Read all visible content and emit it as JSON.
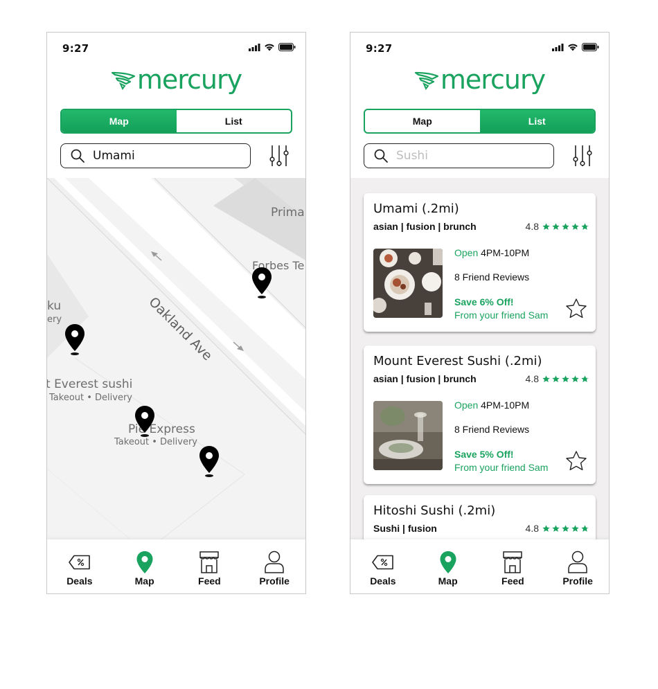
{
  "left_screen": {
    "status": {
      "time": "9:27"
    },
    "logo": {
      "text": "mercury"
    },
    "segment": {
      "map_label": "Map",
      "list_label": "List",
      "active": "Map"
    },
    "search": {
      "value": "Umami",
      "placeholder": ""
    },
    "map": {
      "street_label": "Oakland Ave",
      "labels": {
        "prima": "Prima",
        "forbes": "Forbes Te",
        "ku": "ku",
        "ery": "ery",
        "everest_name": "t Everest sushi",
        "everest_sub": "Takeout • Delivery",
        "pie_name": "Pie Express",
        "pie_sub": "Takeout • Delivery"
      },
      "pin_icon": "map-pin-icon"
    },
    "tabbar": [
      {
        "label": "Deals",
        "icon": "discount-tag-icon"
      },
      {
        "label": "Map",
        "icon": "map-pin-icon",
        "active": true
      },
      {
        "label": "Feed",
        "icon": "storefront-icon"
      },
      {
        "label": "Profile",
        "icon": "user-icon"
      }
    ]
  },
  "right_screen": {
    "status": {
      "time": "9:27"
    },
    "logo": {
      "text": "mercury"
    },
    "segment": {
      "map_label": "Map",
      "list_label": "List",
      "active": "List"
    },
    "search": {
      "value": "",
      "placeholder": "Sushi"
    },
    "restaurants": [
      {
        "name": "Umami (.2mi)",
        "tags": "asian | fusion | brunch",
        "rating": "4.8",
        "open_word": "Open",
        "hours": "4PM-10PM",
        "friend_reviews": "8 Friend Reviews",
        "deal": "Save 6% Off!",
        "deal_source": "From your friend Sam"
      },
      {
        "name": "Mount Everest Sushi (.2mi)",
        "tags": "asian | fusion | brunch",
        "rating": "4.8",
        "open_word": "Open",
        "hours": "4PM-10PM",
        "friend_reviews": "8 Friend Reviews",
        "deal": "Save 5% Off!",
        "deal_source": "From your friend Sam"
      },
      {
        "name": "Hitoshi Sushi (.2mi)",
        "tags": "Sushi | fusion",
        "rating": "4.8"
      }
    ],
    "tabbar": [
      {
        "label": "Deals",
        "icon": "discount-tag-icon"
      },
      {
        "label": "Map",
        "icon": "map-pin-icon",
        "active": true
      },
      {
        "label": "Feed",
        "icon": "storefront-icon"
      },
      {
        "label": "Profile",
        "icon": "user-icon"
      }
    ]
  },
  "colors": {
    "accent": "#1aa35f",
    "star": "#1aa35f",
    "feed_bg": "#f1efef"
  }
}
